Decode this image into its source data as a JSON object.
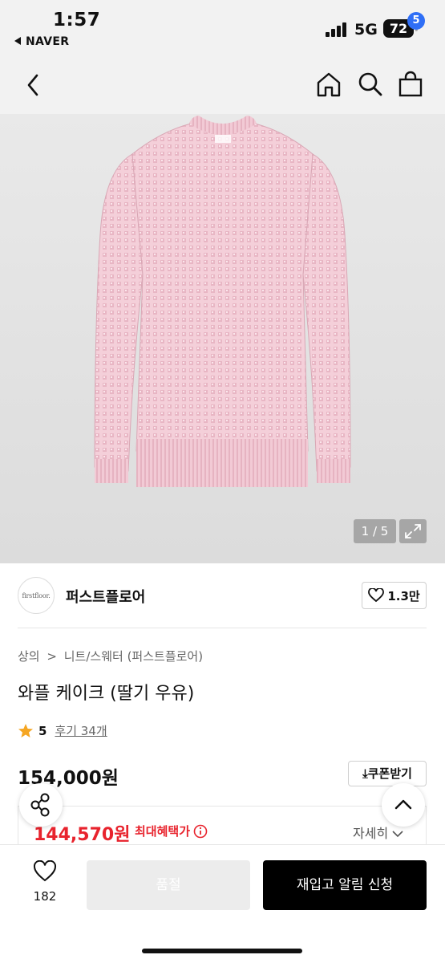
{
  "status_bar": {
    "time": "1:57",
    "back_app": "NAVER",
    "network": "5G",
    "battery": "72"
  },
  "nav": {
    "cart_count": "5"
  },
  "gallery": {
    "counter": "1 / 5"
  },
  "brand": {
    "logo_text": "firstfloor.",
    "name": "퍼스트플로어",
    "likes": "1.3만"
  },
  "breadcrumb": [
    "상의",
    ">",
    "니트/스웨터 (퍼스트플로어)"
  ],
  "product": {
    "title": "와플 케이크 (딸기 우유)",
    "rating": "5",
    "reviews": "후기 34개",
    "price": "154,000원",
    "coupon_label": "쿠폰받기",
    "sale_price": "144,570원",
    "max_benefit_label": "최대혜택가",
    "details_label": "자세히"
  },
  "bottom_bar": {
    "wish_count": "182",
    "soldout_label": "품절",
    "restock_label": "재입고 알림 신청"
  },
  "colors": {
    "accent_red": "#e8232d",
    "badge_blue": "#2f6ff6",
    "sweater_pink": "#f4cfd9"
  }
}
